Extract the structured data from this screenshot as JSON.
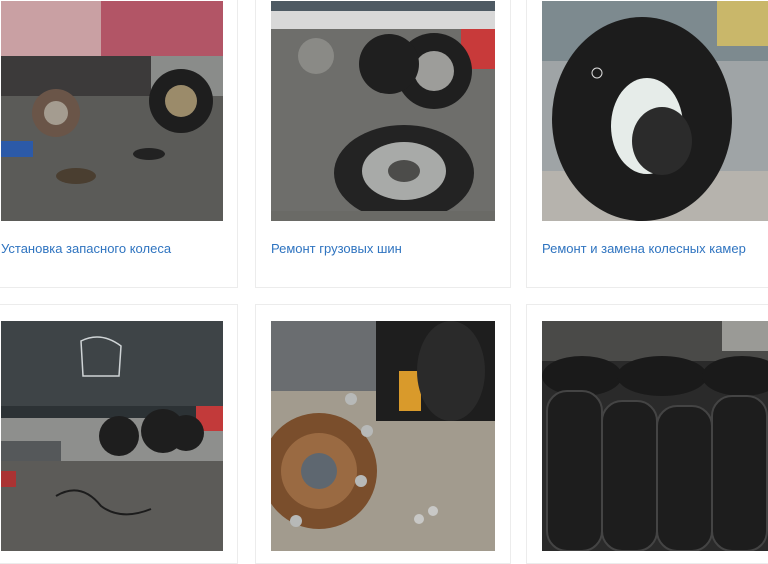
{
  "services": [
    {
      "title": "Установка запасного колеса",
      "image": "truck-wheel-removed-photo"
    },
    {
      "title": "Ремонт грузовых шин",
      "image": "truck-tire-on-ground-photo"
    },
    {
      "title": "Ремонт и замена колесных камер",
      "image": "large-inner-tube-photo"
    },
    {
      "title": "",
      "image": "dump-truck-service-photo"
    },
    {
      "title": "",
      "image": "wheel-hub-and-tire-photo"
    },
    {
      "title": "",
      "image": "stacked-tires-photo"
    }
  ],
  "colors": {
    "link": "#2f74c0",
    "card_border": "#ececec"
  }
}
